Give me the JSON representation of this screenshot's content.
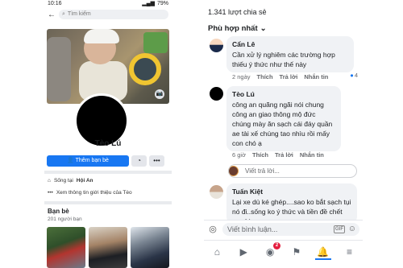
{
  "left_phone": {
    "status_bar": {
      "time": "10:16",
      "battery": "79%"
    },
    "search_placeholder": "Tìm kiếm",
    "profile": {
      "name": "Tèo Lú",
      "add_friend_label": "Thêm bạn bè",
      "lives_in_prefix": "Sống tại",
      "lives_in_place": "Hội An",
      "about_link": "Xem thông tin giới thiệu của Tèo"
    },
    "friends": {
      "title": "Bạn bè",
      "count": "201 người bạn"
    }
  },
  "right_phone": {
    "shares": "1.341 lượt chia sẻ",
    "sort_label": "Phù hợp nhất",
    "comments": [
      {
        "name": "Cẩn Lê",
        "text": "Cần xử lý nghiêm các trường hợp thiếu ý thức như thế này",
        "time": "2 ngày",
        "like": "Thích",
        "reply": "Trả lời",
        "message": "Nhắn tin",
        "reaction_count": "4"
      },
      {
        "name": "Tèo Lú",
        "text": "công an quãng ngãi nói chung công an giao thông mộ đức chúng mày ăn sạch cái đáy quần ae tài xế chúng tao nhìu rồi mấy con chó ạ",
        "time": "6 giờ",
        "like": "Thích",
        "reply": "Trả lời",
        "message": "Nhắn tin"
      },
      {
        "name": "Tuấn Kiệt",
        "text": "Lại xe dù ké ghép....sao ko bắt sạch tụi nó đi..sống ko ý thức và tiền đề chết người."
      }
    ],
    "reply_placeholder": "Viết trả lời...",
    "composer_placeholder": "Viết bình luận...",
    "composer_gif": "GIF",
    "nav_badge": "2"
  },
  "colors": {
    "accent": "#1877f2",
    "badge": "#e41e3f",
    "bubble": "#f0f2f5"
  }
}
